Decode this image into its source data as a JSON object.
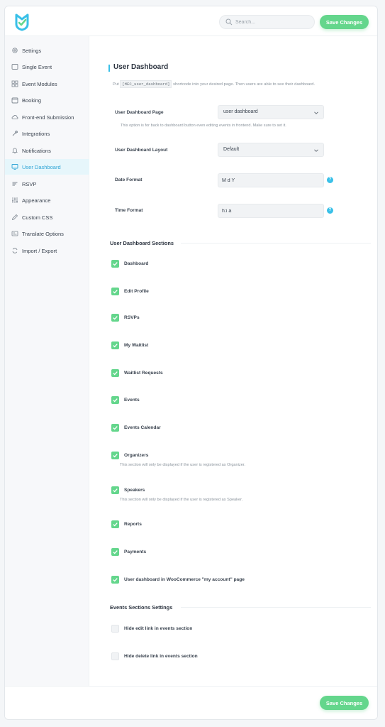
{
  "header": {
    "search_placeholder": "Search...",
    "save_label": "Save Changes",
    "brand_color": "#64d68c",
    "accent_color": "#39c0e8"
  },
  "sidebar": {
    "items": [
      {
        "label": "Settings",
        "icon": "gear-icon",
        "active": false
      },
      {
        "label": "Single Event",
        "icon": "single-event-icon",
        "active": false
      },
      {
        "label": "Event Modules",
        "icon": "modules-icon",
        "active": false
      },
      {
        "label": "Booking",
        "icon": "calendar-icon",
        "active": false
      },
      {
        "label": "Front-end Submission",
        "icon": "cloud-upload-icon",
        "active": false
      },
      {
        "label": "Integrations",
        "icon": "wrench-icon",
        "active": false
      },
      {
        "label": "Notifications",
        "icon": "bell-icon",
        "active": false
      },
      {
        "label": "User Dashboard",
        "icon": "monitor-icon",
        "active": true
      },
      {
        "label": "RSVP",
        "icon": "rsvp-icon",
        "active": false
      },
      {
        "label": "Appearance",
        "icon": "sliders-icon",
        "active": false
      },
      {
        "label": "Custom CSS",
        "icon": "pen-icon",
        "active": false
      },
      {
        "label": "Translate Options",
        "icon": "translate-icon",
        "active": false
      },
      {
        "label": "Import / Export",
        "icon": "sync-icon",
        "active": false
      }
    ]
  },
  "main": {
    "title": "User Dashboard",
    "desc_before": "Put",
    "desc_code": "[MEC_user_dashboard]",
    "desc_after": "shortcode into your desired page. Then users are able to see their dashboard.",
    "fields": {
      "page": {
        "label": "User Dashboard Page",
        "value": "user dashboard",
        "hint": "This option is for back to dashboard button even editing events in frontend. Make sure to set it."
      },
      "layout": {
        "label": "User Dashboard Layout",
        "value": "Default"
      },
      "date_format": {
        "label": "Date Format",
        "value": "M d Y"
      },
      "time_format": {
        "label": "Time Format",
        "value": "h:i a"
      }
    },
    "help_glyph": "?",
    "sections_title": "User Dashboard Sections",
    "sections": [
      {
        "label": "Dashboard",
        "checked": true
      },
      {
        "label": "Edit Profile",
        "checked": true
      },
      {
        "label": "RSVPs",
        "checked": true
      },
      {
        "label": "My Waitlist",
        "checked": true
      },
      {
        "label": "Waitlist Requests",
        "checked": true
      },
      {
        "label": "Events",
        "checked": true
      },
      {
        "label": "Events Calendar",
        "checked": true
      },
      {
        "label": "Organizers",
        "checked": true,
        "hint": "This section will only be displayed if the user is registered as Organizer."
      },
      {
        "label": "Speakers",
        "checked": true,
        "hint": "This section will only be displayed if the user is registered as Speaker."
      },
      {
        "label": "Reports",
        "checked": true
      },
      {
        "label": "Payments",
        "checked": true
      },
      {
        "label": "User dashboard in WooCommerce \"my account\" page",
        "checked": true
      }
    ],
    "events_settings_title": "Events Sections Settings",
    "events_settings": [
      {
        "label": "Hide edit link in events section",
        "checked": false
      },
      {
        "label": "Hide delete link in events section",
        "checked": false
      }
    ]
  }
}
